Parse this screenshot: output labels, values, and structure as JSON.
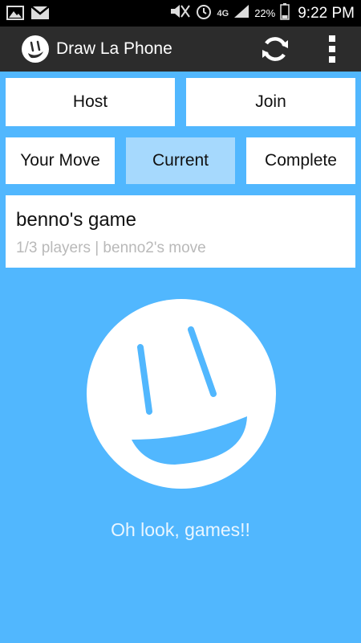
{
  "status_bar": {
    "battery": "22%",
    "time": "9:22 PM",
    "network": "4G",
    "icons": [
      "image-icon",
      "gmail-icon",
      "mute-icon",
      "alarm-icon",
      "signal-icon",
      "battery-icon"
    ]
  },
  "action_bar": {
    "title": "Draw La Phone",
    "icons": [
      "app-logo-icon",
      "refresh-icon",
      "overflow-menu-icon"
    ]
  },
  "top_buttons": {
    "host": "Host",
    "join": "Join"
  },
  "tabs": [
    {
      "label": "Your Move",
      "selected": false
    },
    {
      "label": "Current",
      "selected": true
    },
    {
      "label": "Complete",
      "selected": false
    }
  ],
  "games": [
    {
      "title": "benno's game",
      "subtitle": "1/3 players | benno2's move"
    }
  ],
  "empty_state": {
    "message": "Oh look, games!!"
  },
  "colors": {
    "background": "#51b7fe",
    "action_bar": "#2c2c2c",
    "tab_selected": "#a6d9fd",
    "subtitle_text": "#b9b9b9"
  }
}
